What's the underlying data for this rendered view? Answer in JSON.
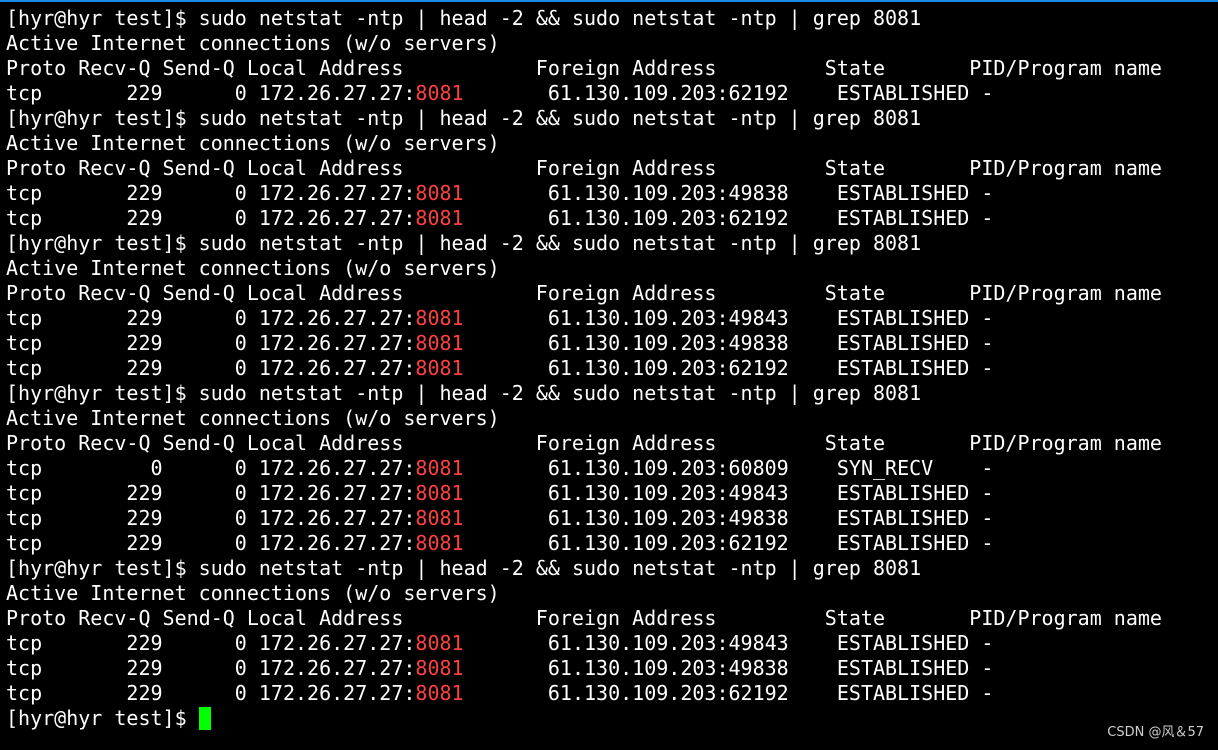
{
  "terminal": {
    "prompt": "[hyr@hyr test]$",
    "command": "sudo netstat -ntp | head -2 && sudo netstat -ntp | grep 8081",
    "heading": "Active Internet connections (w/o servers)",
    "columns": [
      "Proto",
      "Recv-Q",
      "Send-Q",
      "Local Address",
      "Foreign Address",
      "State",
      "PID/Program name"
    ],
    "local_ip_prefix": "172.26.27.27:",
    "port_highlight": "8081",
    "outputs": [
      {
        "rows": [
          {
            "proto": "tcp",
            "recvq": "229",
            "sendq": "0",
            "foreign": "61.130.109.203:62192",
            "state": "ESTABLISHED",
            "pid": "-"
          }
        ]
      },
      {
        "rows": [
          {
            "proto": "tcp",
            "recvq": "229",
            "sendq": "0",
            "foreign": "61.130.109.203:49838",
            "state": "ESTABLISHED",
            "pid": "-"
          },
          {
            "proto": "tcp",
            "recvq": "229",
            "sendq": "0",
            "foreign": "61.130.109.203:62192",
            "state": "ESTABLISHED",
            "pid": "-"
          }
        ]
      },
      {
        "rows": [
          {
            "proto": "tcp",
            "recvq": "229",
            "sendq": "0",
            "foreign": "61.130.109.203:49843",
            "state": "ESTABLISHED",
            "pid": "-"
          },
          {
            "proto": "tcp",
            "recvq": "229",
            "sendq": "0",
            "foreign": "61.130.109.203:49838",
            "state": "ESTABLISHED",
            "pid": "-"
          },
          {
            "proto": "tcp",
            "recvq": "229",
            "sendq": "0",
            "foreign": "61.130.109.203:62192",
            "state": "ESTABLISHED",
            "pid": "-"
          }
        ]
      },
      {
        "rows": [
          {
            "proto": "tcp",
            "recvq": "0",
            "sendq": "0",
            "foreign": "61.130.109.203:60809",
            "state": "SYN_RECV",
            "pid": "-"
          },
          {
            "proto": "tcp",
            "recvq": "229",
            "sendq": "0",
            "foreign": "61.130.109.203:49843",
            "state": "ESTABLISHED",
            "pid": "-"
          },
          {
            "proto": "tcp",
            "recvq": "229",
            "sendq": "0",
            "foreign": "61.130.109.203:49838",
            "state": "ESTABLISHED",
            "pid": "-"
          },
          {
            "proto": "tcp",
            "recvq": "229",
            "sendq": "0",
            "foreign": "61.130.109.203:62192",
            "state": "ESTABLISHED",
            "pid": "-"
          }
        ]
      },
      {
        "rows": [
          {
            "proto": "tcp",
            "recvq": "229",
            "sendq": "0",
            "foreign": "61.130.109.203:49843",
            "state": "ESTABLISHED",
            "pid": "-"
          },
          {
            "proto": "tcp",
            "recvq": "229",
            "sendq": "0",
            "foreign": "61.130.109.203:49838",
            "state": "ESTABLISHED",
            "pid": "-"
          },
          {
            "proto": "tcp",
            "recvq": "229",
            "sendq": "0",
            "foreign": "61.130.109.203:62192",
            "state": "ESTABLISHED",
            "pid": "-"
          }
        ]
      }
    ]
  },
  "watermark": "CSDN @风＆57",
  "colors": {
    "background": "#000000",
    "text": "#ffffff",
    "highlight": "#ff4040",
    "cursor": "#00ff00",
    "top_border": "#1e88e5"
  }
}
